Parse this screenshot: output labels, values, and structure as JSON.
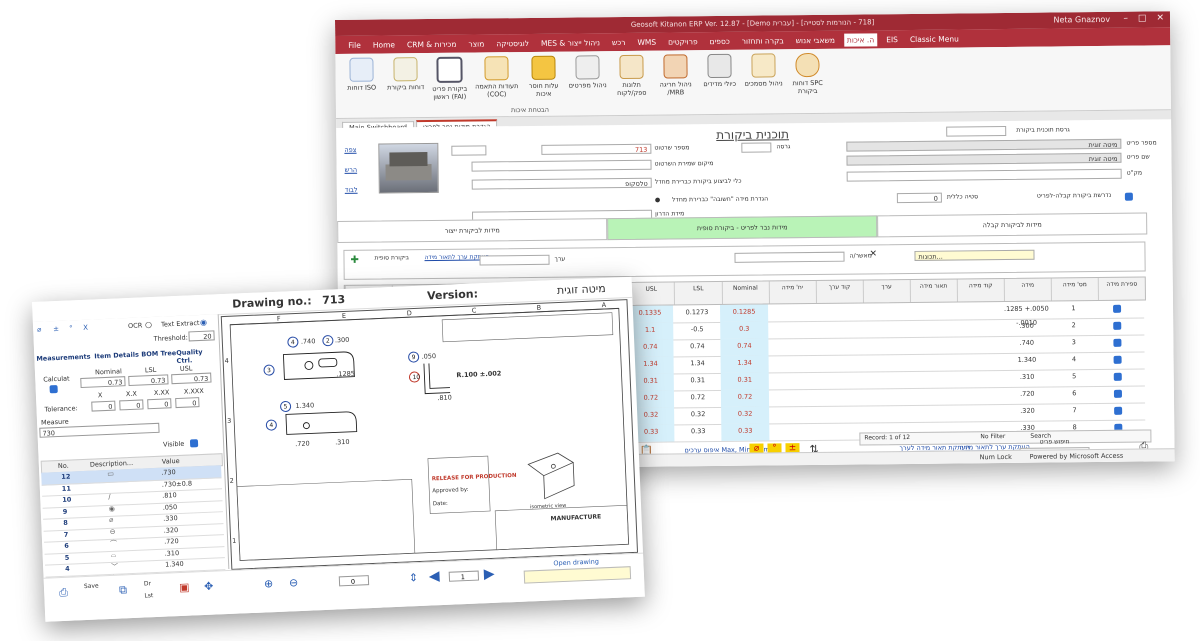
{
  "erp": {
    "title": "Geosoft Kitanon ERP Ver. 12.87 - [Demo עברית] - [718 - הנורמות לסטייה]",
    "user": "Neta Gnaznov",
    "menu": [
      "File",
      "Home",
      "CRM & מכירות",
      "מוצר",
      "לוגיסטיקה",
      "MES & ניהול ייצור",
      "רכש",
      "WMS",
      "פרויקטים",
      "כספים",
      "בקרה ותחזור",
      "משאבי אנוש",
      "ה. איכות",
      "EIS",
      "Classic Menu"
    ],
    "ribbon": [
      {
        "label": "דוחות ISO",
        "icon": "report-icon"
      },
      {
        "label": "דוחות ביקורת",
        "icon": "checklist-icon"
      },
      {
        "label": "ביקורת פריט ראשון (FAI)",
        "icon": "magnifier-icon"
      },
      {
        "label": "תעודות התאמה (COC)",
        "icon": "certificate-icon"
      },
      {
        "label": "עלות חוסר איכות",
        "icon": "coins-icon"
      },
      {
        "label": "ניהול מפרטים",
        "icon": "spec-icon"
      },
      {
        "label": "תלונות ספק/לקוח",
        "icon": "complaint-icon"
      },
      {
        "label": "ניהול חריגה /MRB",
        "icon": "deviation-icon"
      },
      {
        "label": "כיולי מדידים",
        "icon": "caliper-icon"
      },
      {
        "label": "ניהול מסמכים",
        "icon": "documents-icon"
      },
      {
        "label": "דוחות SPC ביקורת",
        "icon": "spc-chart-icon"
      }
    ],
    "ribbon_group": "הבטחת איכות",
    "doc_tabs": [
      "Main Switchboard",
      "הגדרת מידות נפר לפריט"
    ],
    "form": {
      "title": "תוכנית ביקורת",
      "plan_version_label": "גרסת תוכנית ביקורת",
      "item_number_label": "מספר פריט",
      "item_number": "מיטה זוגית",
      "item_name_label": "שם פריט",
      "item_name": "מיטה זוגית",
      "sku_label": "מק\"ט",
      "drawing_number_label": "מספר שרטוט",
      "drawing_number": "713",
      "version_label": "גרסה",
      "measure_location_label": "מיקום שמירת השרטוט",
      "tool_label": "כלי לביצוע ביקורת כברירת מחדל",
      "tool": "טלסקופ",
      "tolerance_label": "סטיה כללית",
      "tolerance": "0",
      "gen_measure_label": "הגדרת מידה \"חשובה\" כברירת מחדל",
      "required_label": "נדרשת ביקורת קבלה-לפריט",
      "drawing_level_label": "מידת הדרון",
      "links": [
        "צפה",
        "הרש",
        "לבוד"
      ],
      "tabs": [
        "מידות לביקורת קבלה",
        "מידות נבר לפריט - ביקורת סופית",
        "מידות לביקורת ייצור"
      ],
      "filter_label": "מאשר/ה",
      "range_label": "ערך",
      "filter_tools": "תכונות...",
      "final_inspection_label": "ביקורת סופית",
      "copy_links": [
        "העתקת ערך לתאור מידה"
      ],
      "columns": [
        "ספירת מידה",
        "מס' מידה",
        "מידה",
        "קוד מידה",
        "תאור מידה",
        "ערך",
        "קוד ערך",
        "יח' מידה",
        "Nominal",
        "LSL",
        "USL",
        "דרגת חשיבות",
        "כלי מדידה",
        "הערות",
        "הוצאה כברירת מחדל",
        "תמונה",
        "שם מדיד"
      ],
      "rows": [
        {
          "num": "1",
          "measure": ".1285 +.0050 -.0010",
          "nominal": "0.1285",
          "lsl": "0.1273",
          "usl": "0.1335",
          "tool": "טלסקופ"
        },
        {
          "num": "2",
          "measure": ".300",
          "nominal": "0.3",
          "lsl": "-0.5",
          "usl": "1.1",
          "tool": ""
        },
        {
          "num": "3",
          "measure": ".740",
          "nominal": "0.74",
          "lsl": "0.74",
          "usl": "0.74",
          "tool": ""
        },
        {
          "num": "4",
          "measure": "1.340",
          "nominal": "1.34",
          "lsl": "1.34",
          "usl": "1.34",
          "tool": ""
        },
        {
          "num": "5",
          "measure": ".310",
          "nominal": "0.31",
          "lsl": "0.31",
          "usl": "0.31",
          "tool": ""
        },
        {
          "num": "6",
          "measure": ".720",
          "nominal": "0.72",
          "lsl": "0.72",
          "usl": "0.72",
          "tool": ""
        },
        {
          "num": "7",
          "measure": ".320",
          "nominal": "0.32",
          "lsl": "0.32",
          "usl": "0.32",
          "tool": ""
        },
        {
          "num": "8",
          "measure": ".330",
          "nominal": "0.33",
          "lsl": "0.33",
          "usl": "0.33",
          "tool": ""
        }
      ],
      "record_nav": "Record: 1 of 12",
      "no_filter": "No Filter",
      "search": "Search",
      "bottom_links": [
        "איפוס ערכים Max, Min, Nom",
        "העתקת תאור מידה לערך",
        "העתקת ערך לתאור מידה"
      ],
      "search_item_label": "חיפוש פריט",
      "search_item": "מיטה זוגית"
    },
    "status": [
      "Num Lock",
      "Powered by Microsoft Access"
    ]
  },
  "drawing": {
    "header_drawing_label": "Drawing no.:",
    "drawing_no": "713",
    "header_version_label": "Version:",
    "item_name": "מיטה זוגית",
    "ocr_label": "OCR",
    "text_extract_label": "Text Extract",
    "threshold_label": "Threshold:",
    "threshold": "20",
    "tabs": [
      "Measurements",
      "Item Details",
      "BOM Tree",
      "Quality Ctrl."
    ],
    "calculat_label": "Calculat",
    "nominal_label": "Nominal",
    "lsl_label": "LSL",
    "usl_label": "USL",
    "nominal": "0.73",
    "lsl": "0.73",
    "usl": "0.73",
    "tolerance_label": "Tolerance:",
    "tol_headers": [
      "X",
      "X.X",
      "X.XX",
      "X.XXX"
    ],
    "tol_values": [
      "0",
      "0",
      "0",
      "0"
    ],
    "measure_label": "Measure",
    "measure_value": "730",
    "visible_label": "Visible",
    "table_headers": [
      "No.",
      "Description...",
      "Value"
    ],
    "rows": [
      {
        "no": "12",
        "glyph": "▭",
        "value": ".730"
      },
      {
        "no": "11",
        "glyph": "",
        "value": ".730±0.8"
      },
      {
        "no": "10",
        "glyph": "/",
        "value": ".810"
      },
      {
        "no": "9",
        "glyph": "◉",
        "value": ".050"
      },
      {
        "no": "8",
        "glyph": "⌀",
        "value": ".330"
      },
      {
        "no": "7",
        "glyph": "⊖",
        "value": ".320"
      },
      {
        "no": "6",
        "glyph": "⌒",
        "value": ".720"
      },
      {
        "no": "5",
        "glyph": "⌓",
        "value": ".310"
      },
      {
        "no": "4",
        "glyph": "﹀",
        "value": "1.340"
      },
      {
        "no": "3",
        "glyph": "/",
        "value": ".740"
      },
      {
        "no": "2",
        "glyph": "◠",
        "value": ".300±0.8"
      }
    ],
    "zones_top": [
      "F",
      "E",
      "D",
      "C",
      "B",
      "A"
    ],
    "zones_side": [
      "4",
      "3",
      "2",
      "1"
    ],
    "dims": [
      ".740",
      ".300",
      ".1285",
      ".050",
      "1.340",
      ".720",
      ".310",
      ".810",
      "R.100 ±.002"
    ],
    "release_text": "RELEASE FOR PRODUCTION",
    "approved_label": "Approved by:",
    "date_label": "Date:",
    "title_block": "MANUFACTURE",
    "isometric_label": "isometric view",
    "page": "1",
    "zoom_field": "0",
    "open_drawing_label": "Open drawing",
    "footer_labels": [
      "Save",
      "Clear List",
      "Dr",
      "Lst"
    ]
  },
  "colors": {
    "brand": "#b0313c",
    "accent": "#2b5fb4",
    "highlight": "#d6f0fb",
    "green_tab": "#b9f3b7"
  }
}
